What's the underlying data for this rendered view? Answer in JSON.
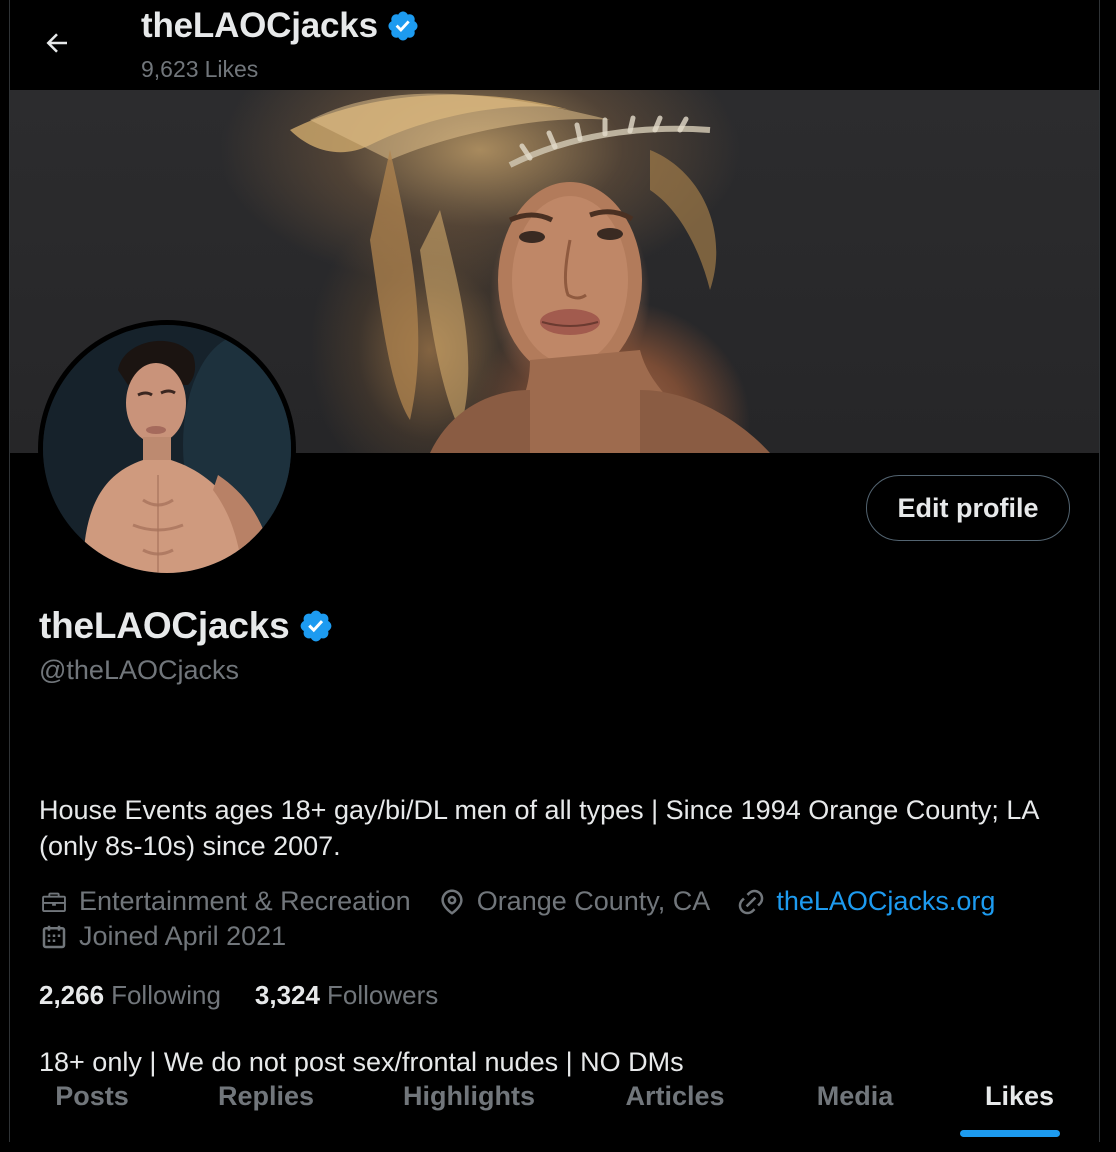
{
  "header": {
    "title": "theLAOCjacks",
    "likes_count": "9,623",
    "likes_label": "Likes"
  },
  "profile": {
    "display_name": "theLAOCjacks",
    "handle": "@theLAOCjacks",
    "verified": true,
    "edit_label": "Edit profile",
    "bio_line1": "House Events ages 18+ gay/bi/DL men of all types | Since 1994 Orange County; LA (only 8s-10s) since 2007.",
    "bio_line2": "18+ only | We do not post sex/frontal nudes | NO DMs",
    "category": "Entertainment & Recreation",
    "location": "Orange County, CA",
    "website": "theLAOCjacks.org",
    "joined": "Joined April 2021",
    "following_count": "2,266",
    "following_label": "Following",
    "followers_count": "3,324",
    "followers_label": "Followers"
  },
  "tabs": [
    {
      "label": "Posts"
    },
    {
      "label": "Replies"
    },
    {
      "label": "Highlights"
    },
    {
      "label": "Articles"
    },
    {
      "label": "Media"
    },
    {
      "label": "Likes"
    }
  ],
  "active_tab": "Likes",
  "colors": {
    "accent": "#1d9bf0",
    "background": "#000000",
    "text": "#e7e9ea",
    "muted": "#71767b",
    "verified_badge": "#1d9bf0"
  },
  "icons": [
    "back-arrow-icon",
    "verified-badge-icon",
    "briefcase-icon",
    "location-pin-icon",
    "link-icon",
    "calendar-icon"
  ]
}
